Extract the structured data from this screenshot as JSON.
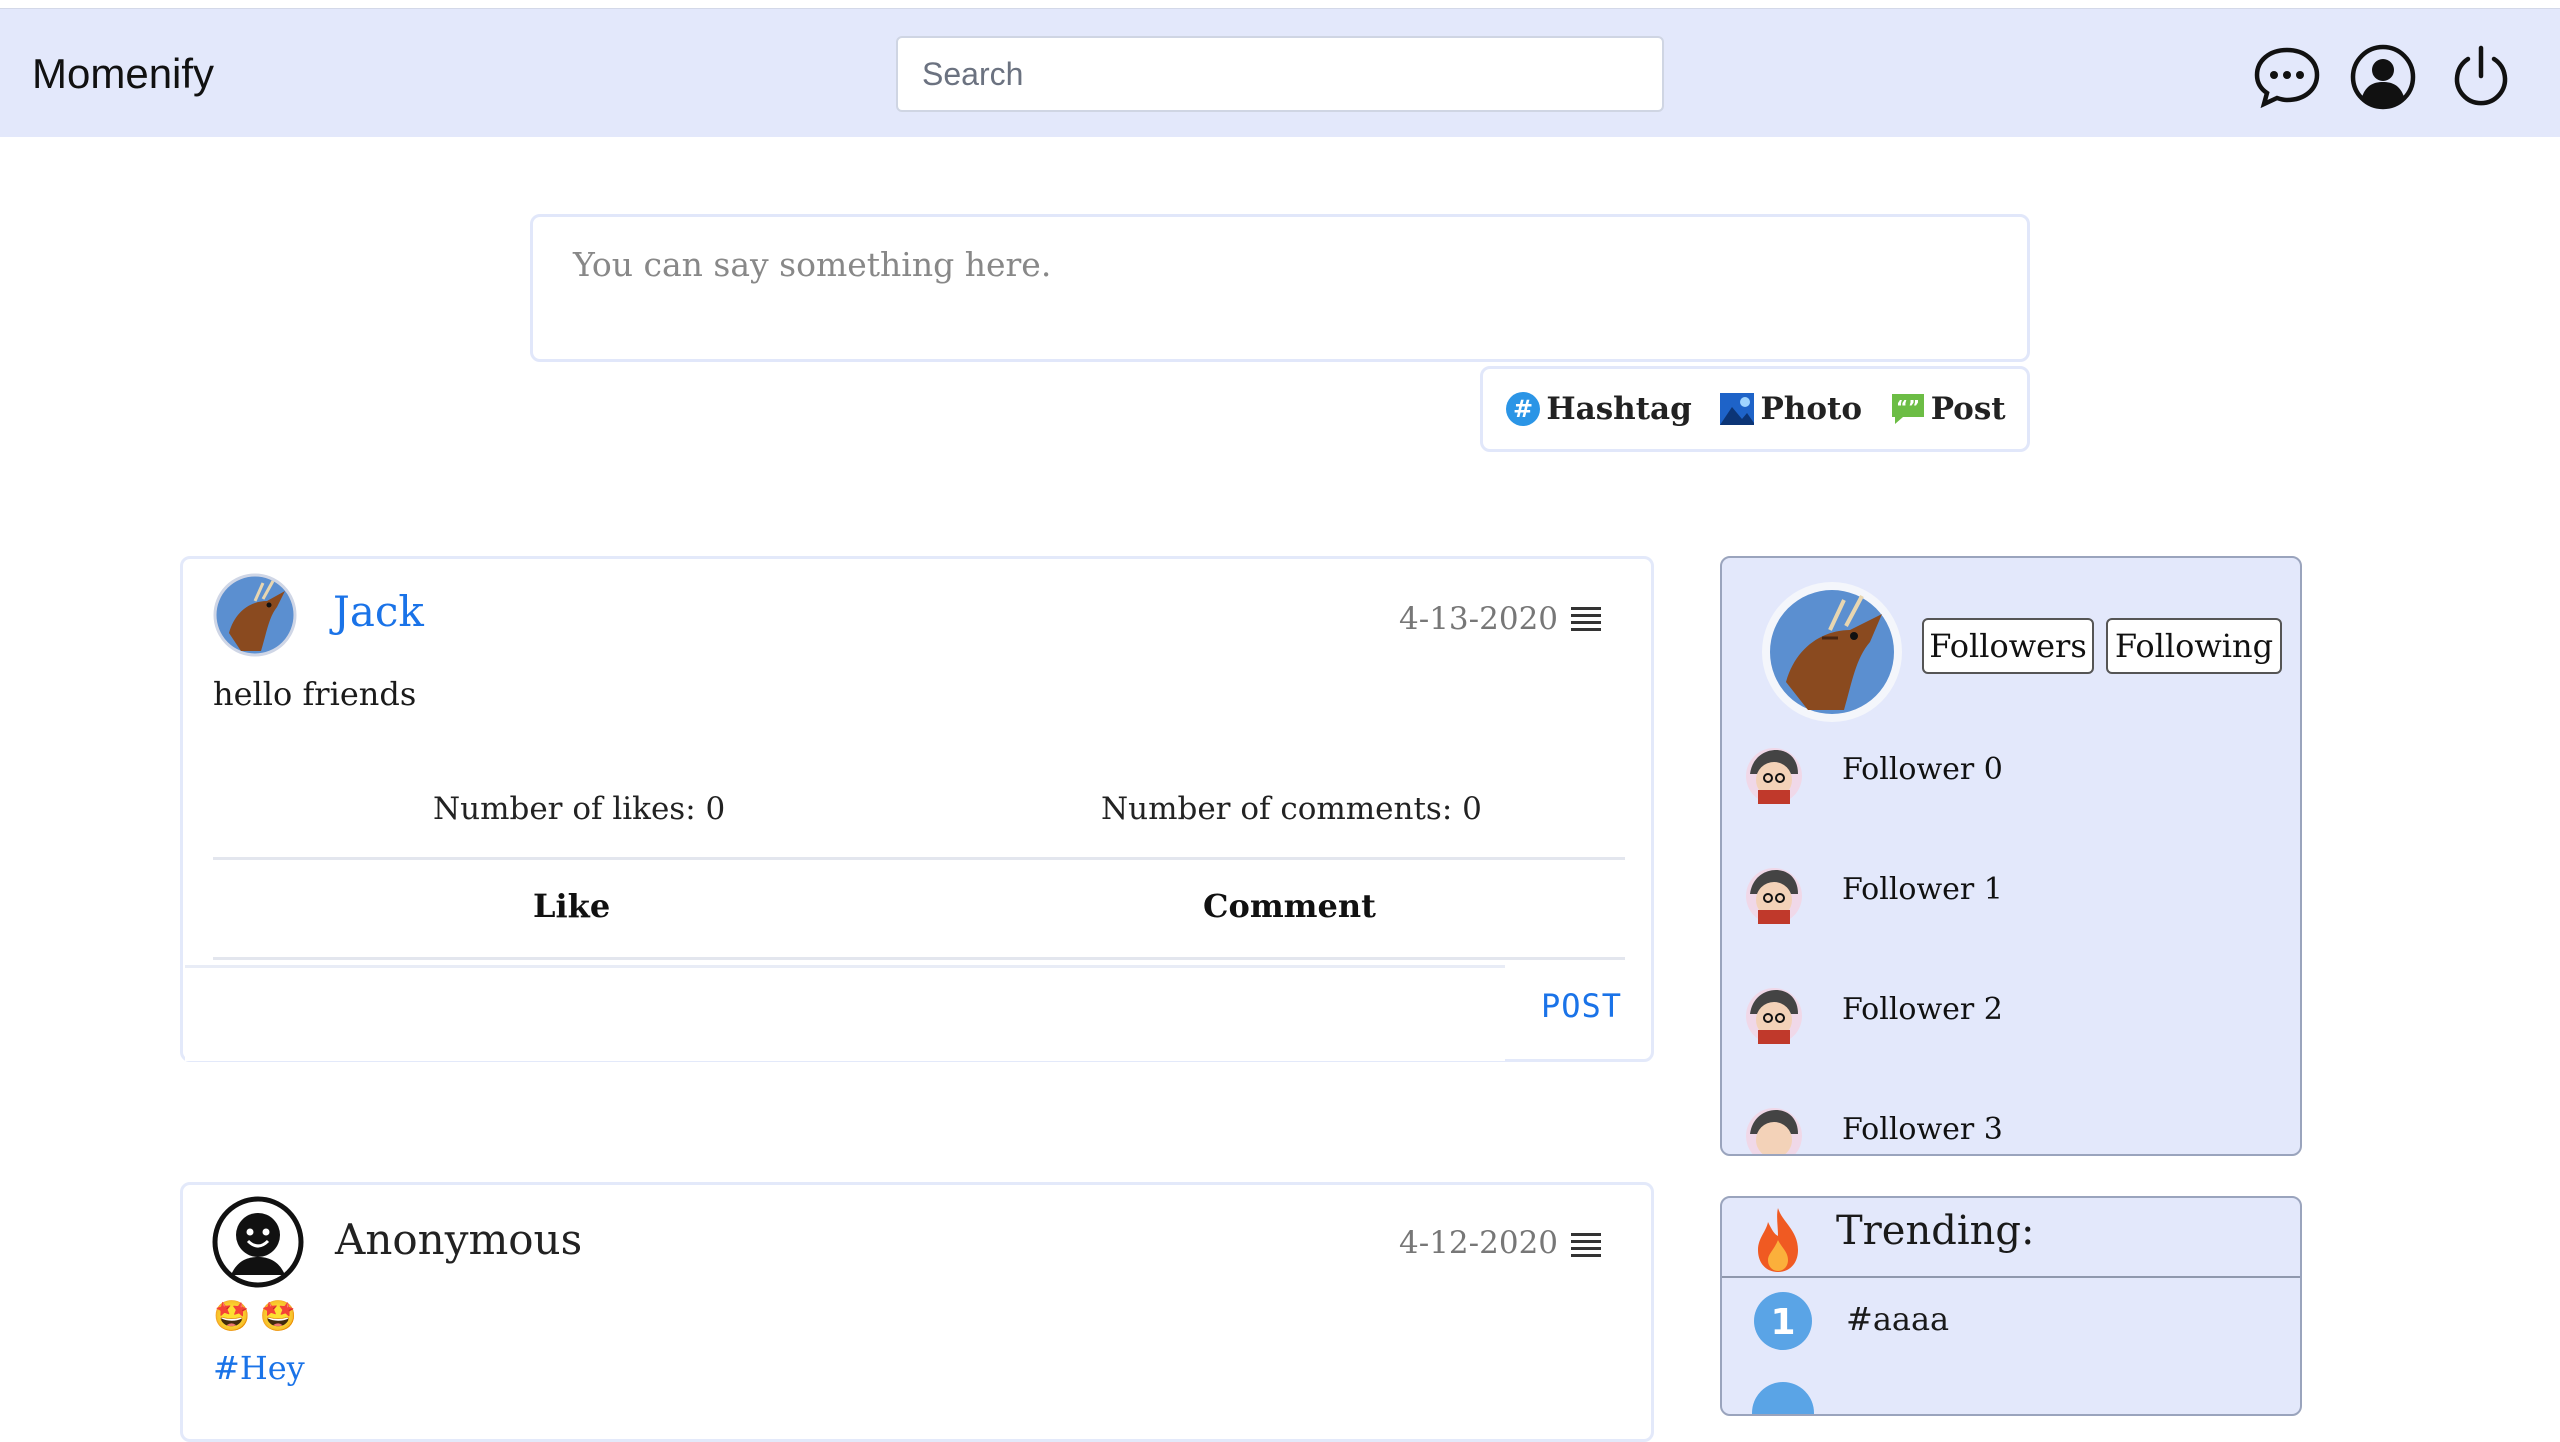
{
  "header": {
    "brand": "Momenify",
    "search_placeholder": "Search",
    "icons": [
      "chat-icon",
      "user-icon",
      "power-icon"
    ]
  },
  "composer": {
    "placeholder": "You can say something here.",
    "hashtag_label": "Hashtag",
    "photo_label": "Photo",
    "post_label": "Post"
  },
  "posts": [
    {
      "author": "Jack",
      "date": "4-13-2020",
      "text": "hello friends",
      "likes_label": "Number of likes: 0",
      "comments_label": "Number of comments: 0",
      "like_label": "Like",
      "comment_label": "Comment",
      "post_btn": "POST"
    },
    {
      "author": "Anonymous",
      "date": "4-12-2020",
      "text": "🤩 🤩",
      "hashtag": "#Hey"
    }
  ],
  "profile": {
    "followers_label": "Followers",
    "following_label": "Following",
    "followers": [
      "Follower 0",
      "Follower 1",
      "Follower 2",
      "Follower 3"
    ]
  },
  "trending": {
    "title": "Trending:",
    "items": [
      {
        "rank": "1",
        "tag": "#aaaa"
      }
    ]
  },
  "colors": {
    "header_bg": "#e3e8fb",
    "accent": "#1a73e8",
    "panel_bg": "#e3e8fb"
  }
}
